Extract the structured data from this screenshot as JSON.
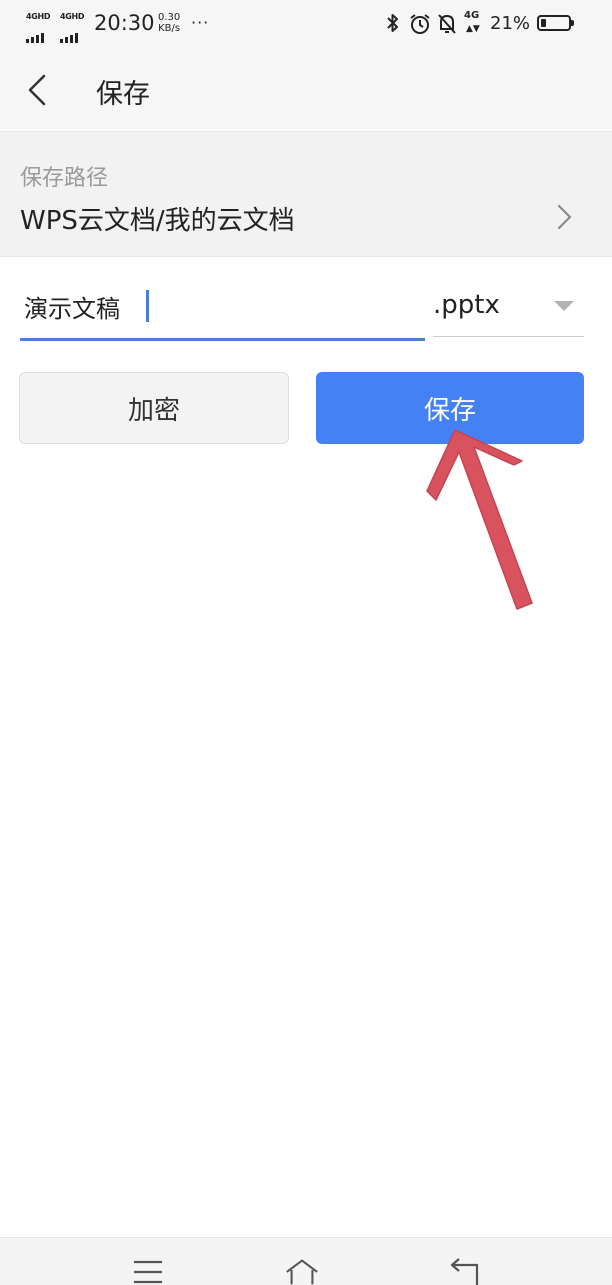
{
  "status_bar": {
    "sim1": "4GHD",
    "sim2": "4GHD",
    "time": "20:30",
    "speed_value": "0.30",
    "speed_unit": "KB/s",
    "more": "···",
    "lte": "4G",
    "battery": "21%",
    "battery_level": 0.21,
    "icons": [
      "bluetooth-icon",
      "alarm-icon",
      "bell-muted-icon",
      "lte-signal-icon"
    ]
  },
  "header": {
    "back_icon": "chevron-left-icon",
    "title": "保存"
  },
  "save_path": {
    "label": "保存路径",
    "value": "WPS云文档/我的云文档",
    "chevron_icon": "chevron-right-icon"
  },
  "file": {
    "name": "演示文稿",
    "extension": ".pptx",
    "extension_icon": "dropdown-triangle-icon"
  },
  "buttons": {
    "encrypt": "加密",
    "save": "保存"
  },
  "colors": {
    "accent": "#4481f4",
    "input_underline": "#4a7fd6",
    "annotation_arrow": "#d9535f"
  },
  "nav_bar": {
    "icons": [
      "menu-icon",
      "home-icon",
      "back-icon"
    ]
  }
}
